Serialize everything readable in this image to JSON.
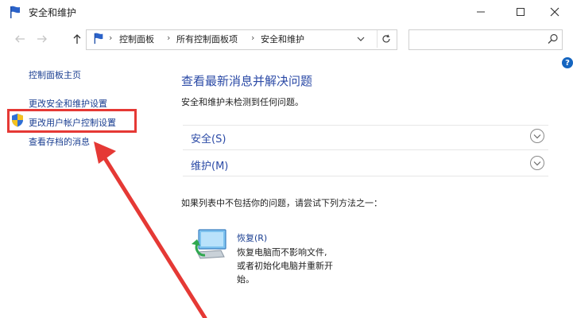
{
  "window": {
    "title": "安全和维护"
  },
  "address": {
    "crumbs": [
      "控制面板",
      "所有控制面板项",
      "安全和维护"
    ],
    "search_placeholder": ""
  },
  "sidebar": {
    "links": [
      {
        "label": "控制面板主页"
      },
      {
        "label": "更改安全和维护设置"
      },
      {
        "label": "更改用户帐户控制设置"
      },
      {
        "label": "查看存档的消息"
      }
    ]
  },
  "main": {
    "title": "查看最新消息并解决问题",
    "subtitle": "安全和维护未检测到任何问题。",
    "sections": [
      {
        "label": "安全(S)"
      },
      {
        "label": "维护(M)"
      }
    ],
    "hint": "如果列表中不包括你的问题，请尝试下列方法之一：",
    "recovery": {
      "link": "恢复(R)",
      "desc": [
        "恢复电脑而不影响文件,",
        "或者初始化电脑并重新开",
        "始。"
      ]
    }
  },
  "colors": {
    "link": "#1a3e91",
    "heading": "#2b4aa6",
    "highlight": "#e53935",
    "help": "#1565c0"
  },
  "icons": [
    "flag-icon",
    "minimize-icon",
    "maximize-icon",
    "close-icon",
    "back-arrow-icon",
    "forward-arrow-icon",
    "up-arrow-icon",
    "chevron-down-icon",
    "refresh-icon",
    "search-icon",
    "shield-icon",
    "chevron-circle-icon",
    "recovery-icon"
  ]
}
